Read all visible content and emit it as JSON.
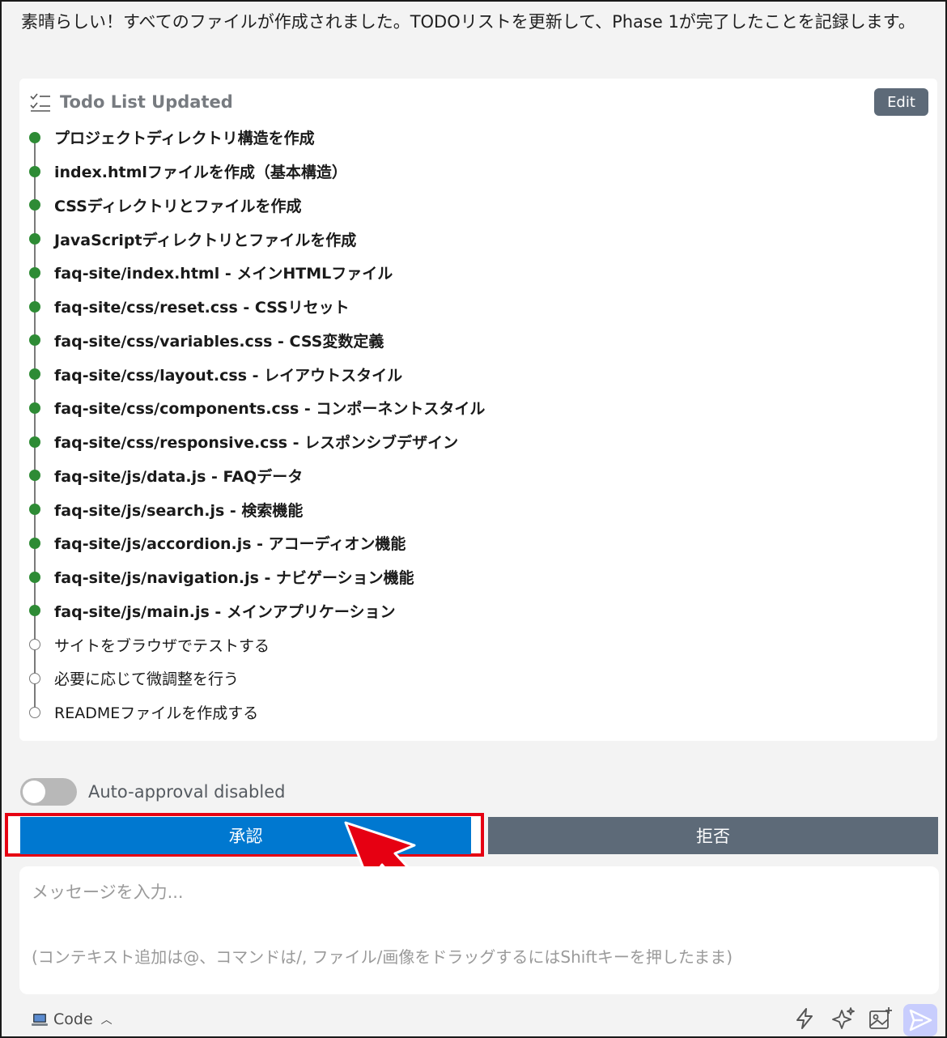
{
  "message": {
    "intro": "素晴らしい！すべてのファイルが作成されました。TODOリストを更新して、Phase 1が完了したことを記録します。"
  },
  "todo": {
    "title": "Todo List Updated",
    "edit_label": "Edit",
    "header_icon": "checklist-icon",
    "items": [
      {
        "text": "プロジェクトディレクトリ構造を作成",
        "done": true
      },
      {
        "text": "index.htmlファイルを作成（基本構造）",
        "done": true
      },
      {
        "text": "CSSディレクトリとファイルを作成",
        "done": true
      },
      {
        "text": "JavaScriptディレクトリとファイルを作成",
        "done": true
      },
      {
        "text": "faq-site/index.html - メインHTMLファイル",
        "done": true
      },
      {
        "text": "faq-site/css/reset.css - CSSリセット",
        "done": true
      },
      {
        "text": "faq-site/css/variables.css - CSS変数定義",
        "done": true
      },
      {
        "text": "faq-site/css/layout.css - レイアウトスタイル",
        "done": true
      },
      {
        "text": "faq-site/css/components.css - コンポーネントスタイル",
        "done": true
      },
      {
        "text": "faq-site/css/responsive.css - レスポンシブデザイン",
        "done": true
      },
      {
        "text": "faq-site/js/data.js - FAQデータ",
        "done": true
      },
      {
        "text": "faq-site/js/search.js - 検索機能",
        "done": true
      },
      {
        "text": "faq-site/js/accordion.js - アコーディオン機能",
        "done": true
      },
      {
        "text": "faq-site/js/navigation.js - ナビゲーション機能",
        "done": true
      },
      {
        "text": "faq-site/js/main.js - メインアプリケーション",
        "done": true
      },
      {
        "text": "サイトをブラウザでテストする",
        "done": false
      },
      {
        "text": "必要に応じて微調整を行う",
        "done": false
      },
      {
        "text": "READMEファイルを作成する",
        "done": false
      }
    ]
  },
  "auto_approval": {
    "label": "Auto-approval disabled",
    "enabled": false
  },
  "actions": {
    "approve_label": "承認",
    "reject_label": "拒否"
  },
  "composer": {
    "placeholder": "メッセージを入力...",
    "hint": "(コンテキスト追加は@、コマンドは/, ファイル/画像をドラッグするにはShiftキーを押したまま)"
  },
  "footer": {
    "mode_label": "Code",
    "mode_icon": "laptop-icon",
    "icons": [
      "lightning-icon",
      "sparkle-icon",
      "add-image-icon",
      "send-icon"
    ]
  },
  "colors": {
    "done_dot": "#2e8b35",
    "approve": "#0078d0",
    "reject": "#5d6a78",
    "highlight": "#e60012",
    "send": "#c8cdfd"
  }
}
